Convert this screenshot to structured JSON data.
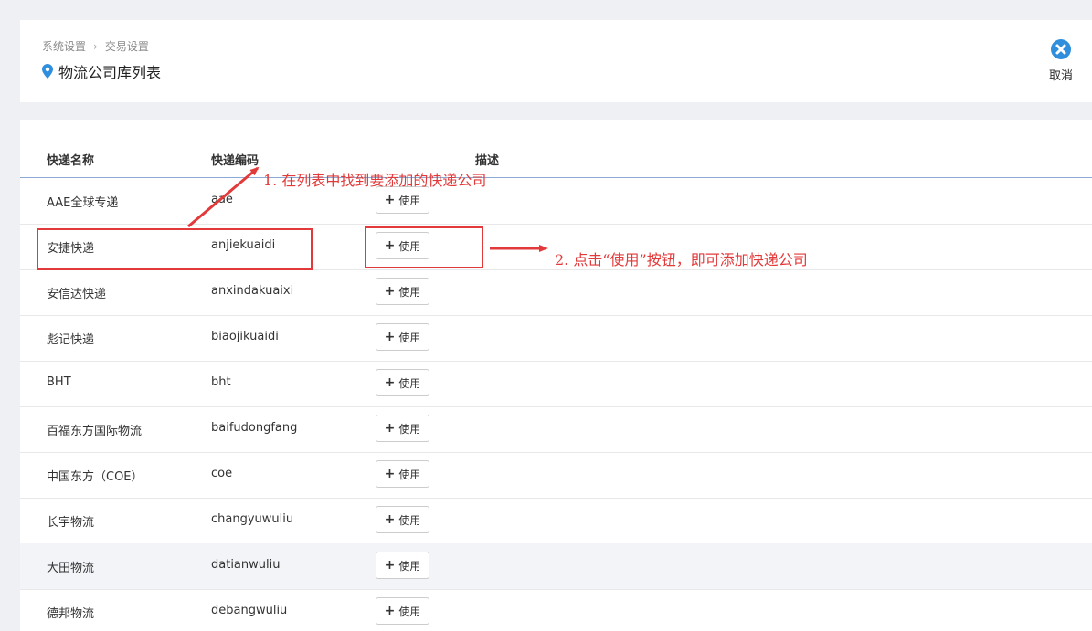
{
  "breadcrumb": {
    "items": [
      "系统设置",
      "交易设置"
    ],
    "separator": "›"
  },
  "page_title": "物流公司库列表",
  "cancel_label": "取消",
  "colors": {
    "accent": "#2f8fdd",
    "annotation": "#e23a3a"
  },
  "table": {
    "headers": [
      "快递名称",
      "快递编码",
      "描述"
    ],
    "use_label": "使用",
    "rows": [
      {
        "name": "AAE全球专递",
        "code": "aae"
      },
      {
        "name": "安捷快递",
        "code": "anjiekuaidi"
      },
      {
        "name": "安信达快递",
        "code": "anxindakuaixi"
      },
      {
        "name": "彪记快递",
        "code": "biaojikuaidi"
      },
      {
        "name": "BHT",
        "code": "bht"
      },
      {
        "name": "百福东方国际物流",
        "code": "baifudongfang"
      },
      {
        "name": "中国东方（COE）",
        "code": "coe"
      },
      {
        "name": "长宇物流",
        "code": "changyuwuliu"
      },
      {
        "name": "大田物流",
        "code": "datianwuliu"
      },
      {
        "name": "德邦物流",
        "code": "debangwuliu"
      }
    ]
  },
  "annotations": {
    "step1": "1. 在列表中找到要添加的快递公司",
    "step2": "2. 点击“使用”按钮，即可添加快递公司"
  }
}
